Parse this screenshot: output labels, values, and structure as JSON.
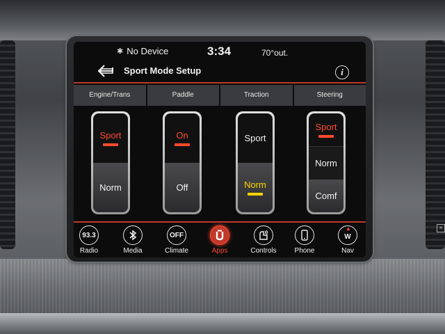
{
  "status": {
    "bt_symbol": "✱",
    "device": "No Device",
    "time": "3:34",
    "temperature": "70°out."
  },
  "header": {
    "title": "Sport Mode Setup",
    "back_icon": "back-arrow-icon",
    "info_label": "i"
  },
  "columns": [
    {
      "label": "Engine/Trans",
      "switch": {
        "top": "Sport",
        "bottom": "Norm",
        "selected": "Sport"
      }
    },
    {
      "label": "Paddle",
      "switch": {
        "top": "On",
        "bottom": "Off",
        "selected": "On"
      }
    },
    {
      "label": "Traction",
      "switch": {
        "top": "Sport",
        "bottom": "Norm",
        "selected": "Norm"
      }
    },
    {
      "label": "Steering",
      "switch": {
        "top": "Sport",
        "middle": "Norm",
        "bottom": "Comf",
        "selected": "Sport"
      }
    }
  ],
  "nav": [
    {
      "label": "Radio",
      "icon_text": "93.3",
      "icon": "radio-icon"
    },
    {
      "label": "Media",
      "icon_text": "",
      "icon": "bluetooth-icon"
    },
    {
      "label": "Climate",
      "icon_text": "OFF",
      "icon": "climate-icon"
    },
    {
      "label": "Apps",
      "icon_text": "",
      "icon": "apps-icon",
      "active": true
    },
    {
      "label": "Controls",
      "icon_text": "",
      "icon": "controls-icon"
    },
    {
      "label": "Phone",
      "icon_text": "",
      "icon": "phone-icon"
    },
    {
      "label": "Nav",
      "icon_text": "W",
      "icon": "compass-icon"
    }
  ],
  "colors": {
    "accent_red": "#ff4a2e",
    "accent_yellow": "#ffd400",
    "divider_red": "#c0392b"
  }
}
